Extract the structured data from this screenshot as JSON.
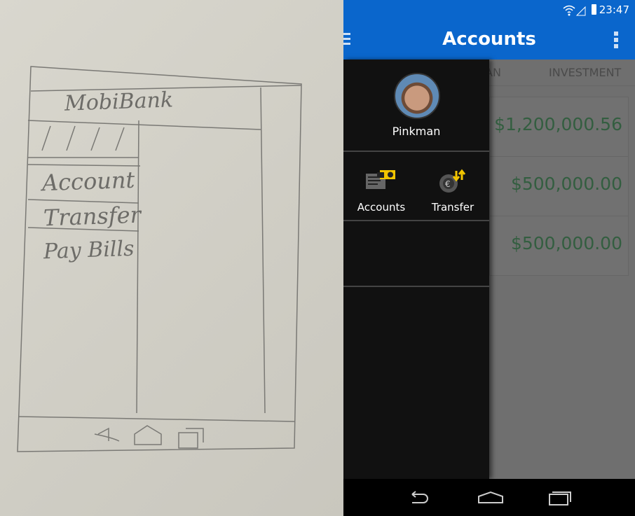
{
  "sketch": {
    "title": "MobiBank",
    "menu_items": [
      "Account",
      "Transfer",
      "Pay Bills"
    ]
  },
  "status_bar": {
    "time": "23:47",
    "icons": [
      "wifi-icon",
      "signal-icon",
      "battery-icon"
    ]
  },
  "toolbar": {
    "title": "Accounts",
    "left_icon": "menu-icon",
    "right_icon": "more-vert-icon"
  },
  "content": {
    "tabs": [
      "AN",
      "INVESTMENT"
    ],
    "amounts": [
      "$1,200,000.56",
      "$500,000.00",
      "$500,000.00"
    ],
    "amount_color": "#2e7d4a"
  },
  "drawer": {
    "user_name": "Pinkman",
    "items": [
      {
        "label": "Accounts",
        "icon": "accounts-card-icon"
      },
      {
        "label": "Transfer",
        "icon": "euro-transfer-icon"
      }
    ]
  },
  "nav_bar": {
    "icons": [
      "back-icon",
      "home-icon",
      "recents-icon"
    ]
  },
  "colors": {
    "primary": "#0a66cc",
    "drawer": "#111111",
    "accent_icon": "#f2c500"
  }
}
